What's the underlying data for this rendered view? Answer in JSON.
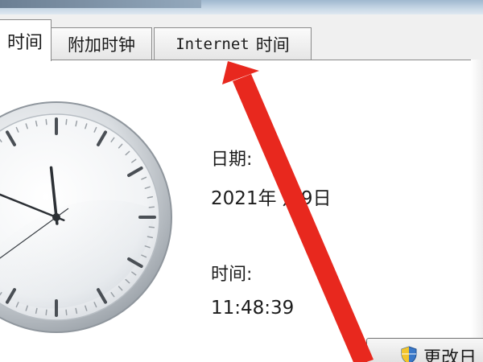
{
  "tabs": {
    "datetime_label": "时间",
    "addclock_label": "附加时钟",
    "internet_prefix": "Internet",
    "internet_suffix": "时间"
  },
  "date_section": {
    "label": "日期:",
    "value": "2021年 月9日"
  },
  "time_section": {
    "label": "时间:",
    "value": "11:48:39"
  },
  "clock": {
    "hour": 11,
    "minute": 48,
    "second": 39
  },
  "change_button": {
    "label": "更改日"
  },
  "colors": {
    "annotation_arrow": "#e8281e",
    "panel_background": "#ffffff",
    "tab_border": "#8a8a8a"
  },
  "icons": {
    "change_button_icon": "uac-shield-icon",
    "annotation": "red-arrow-icon"
  }
}
